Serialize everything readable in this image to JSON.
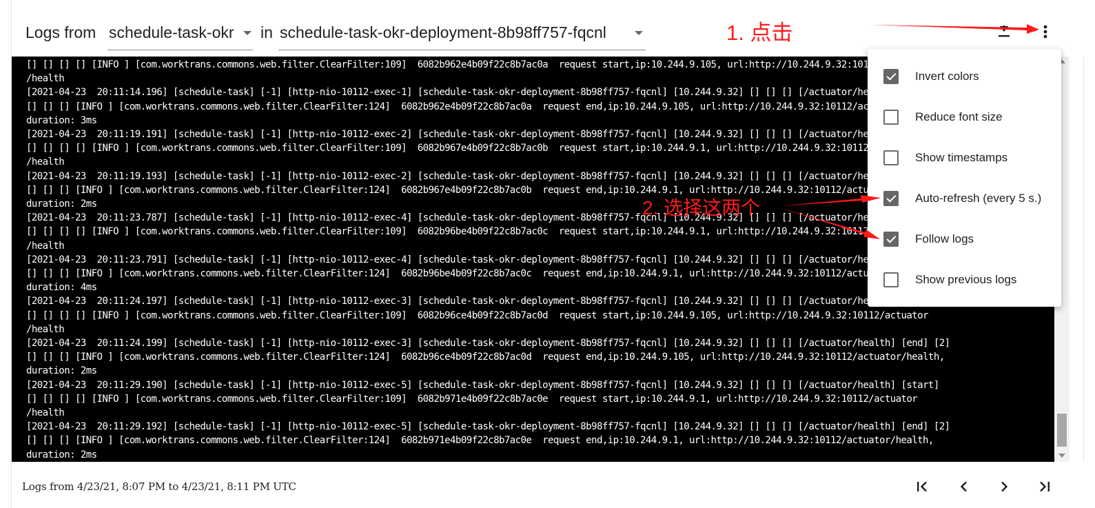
{
  "header": {
    "logs_from": "Logs from",
    "container": "schedule-task-okr",
    "in": "in",
    "pod": "schedule-task-okr-deployment-8b98ff757-fqcnl"
  },
  "log_lines": [
    "[] [] [] [] [INFO ] [com.worktrans.commons.web.filter.ClearFilter:109]  6082b962e4b09f22c8b7ac0a  request start,ip:10.244.9.105, url:http://10.244.9.32:10112/actuator",
    "/health",
    "[2021-04-23  20:11:14.196] [schedule-task] [-1] [http-nio-10112-exec-1] [schedule-task-okr-deployment-8b98ff757-fqcnl] [10.244.9.32] [] [] [] [/actuator/health] [end] [2]",
    "[] [] [] [INFO ] [com.worktrans.commons.web.filter.ClearFilter:124]  6082b962e4b09f22c8b7ac0a  request end,ip:10.244.9.105, url:http://10.244.9.32:10112/actuator/health,",
    "duration: 3ms",
    "[2021-04-23  20:11:19.191] [schedule-task] [-1] [http-nio-10112-exec-2] [schedule-task-okr-deployment-8b98ff757-fqcnl] [10.244.9.32] [] [] [] [/actuator/health] [start]",
    "[] [] [] [] [INFO ] [com.worktrans.commons.web.filter.ClearFilter:109]  6082b967e4b09f22c8b7ac0b  request start,ip:10.244.9.1, url:http://10.244.9.32:10112/actuator",
    "/health",
    "[2021-04-23  20:11:19.193] [schedule-task] [-1] [http-nio-10112-exec-2] [schedule-task-okr-deployment-8b98ff757-fqcnl] [10.244.9.32] [] [] [] [/actuator/health] [end] [2]",
    "[] [] [] [INFO ] [com.worktrans.commons.web.filter.ClearFilter:124]  6082b967e4b09f22c8b7ac0b  request end,ip:10.244.9.1, url:http://10.244.9.32:10112/actuator/health,",
    "duration: 2ms",
    "[2021-04-23  20:11:23.787] [schedule-task] [-1] [http-nio-10112-exec-4] [schedule-task-okr-deployment-8b98ff757-fqcnl] [10.244.9.32] [] [] [] [/actuator/health] [start]",
    "[] [] [] [] [INFO ] [com.worktrans.commons.web.filter.ClearFilter:109]  6082b96be4b09f22c8b7ac0c  request start,ip:10.244.9.1, url:http://10.244.9.32:10112/actuator",
    "/health",
    "[2021-04-23  20:11:23.791] [schedule-task] [-1] [http-nio-10112-exec-4] [schedule-task-okr-deployment-8b98ff757-fqcnl] [10.244.9.32] [] [] [] [/actuator/health] [end] [2]",
    "[] [] [] [INFO ] [com.worktrans.commons.web.filter.ClearFilter:124]  6082b96be4b09f22c8b7ac0c  request end,ip:10.244.9.1, url:http://10.244.9.32:10112/actuator/health,",
    "duration: 4ms",
    "[2021-04-23  20:11:24.197] [schedule-task] [-1] [http-nio-10112-exec-3] [schedule-task-okr-deployment-8b98ff757-fqcnl] [10.244.9.32] [] [] [] [/actuator/health] [start]",
    "[] [] [] [] [INFO ] [com.worktrans.commons.web.filter.ClearFilter:109]  6082b96ce4b09f22c8b7ac0d  request start,ip:10.244.9.105, url:http://10.244.9.32:10112/actuator",
    "/health",
    "[2021-04-23  20:11:24.199] [schedule-task] [-1] [http-nio-10112-exec-3] [schedule-task-okr-deployment-8b98ff757-fqcnl] [10.244.9.32] [] [] [] [/actuator/health] [end] [2]",
    "[] [] [] [INFO ] [com.worktrans.commons.web.filter.ClearFilter:124]  6082b96ce4b09f22c8b7ac0d  request end,ip:10.244.9.105, url:http://10.244.9.32:10112/actuator/health,",
    "duration: 2ms",
    "[2021-04-23  20:11:29.190] [schedule-task] [-1] [http-nio-10112-exec-5] [schedule-task-okr-deployment-8b98ff757-fqcnl] [10.244.9.32] [] [] [] [/actuator/health] [start]",
    "[] [] [] [] [INFO ] [com.worktrans.commons.web.filter.ClearFilter:109]  6082b971e4b09f22c8b7ac0e  request start,ip:10.244.9.1, url:http://10.244.9.32:10112/actuator",
    "/health",
    "[2021-04-23  20:11:29.192] [schedule-task] [-1] [http-nio-10112-exec-5] [schedule-task-okr-deployment-8b98ff757-fqcnl] [10.244.9.32] [] [] [] [/actuator/health] [end] [2]",
    "[] [] [] [INFO ] [com.worktrans.commons.web.filter.ClearFilter:124]  6082b971e4b09f22c8b7ac0e  request end,ip:10.244.9.1, url:http://10.244.9.32:10112/actuator/health,",
    "duration: 2ms"
  ],
  "menu": {
    "items": [
      {
        "label": "Invert colors",
        "checked": true
      },
      {
        "label": "Reduce font size",
        "checked": false
      },
      {
        "label": "Show timestamps",
        "checked": false
      },
      {
        "label": "Auto-refresh (every 5 s.)",
        "checked": true
      },
      {
        "label": "Follow logs",
        "checked": true
      },
      {
        "label": "Show previous logs",
        "checked": false
      }
    ]
  },
  "footer": {
    "range": "Logs from 4/23/21, 8:07 PM to 4/23/21, 8:11 PM UTC"
  },
  "annotations": {
    "step1": "1. 点击",
    "step2": "2. 选择这两个",
    "color": "#ff1a1a"
  },
  "icons": {
    "download": "download-icon",
    "more": "more-vert-icon",
    "first": "first-page-icon",
    "prev": "chevron-left-icon",
    "next": "chevron-right-icon",
    "last": "last-page-icon"
  }
}
